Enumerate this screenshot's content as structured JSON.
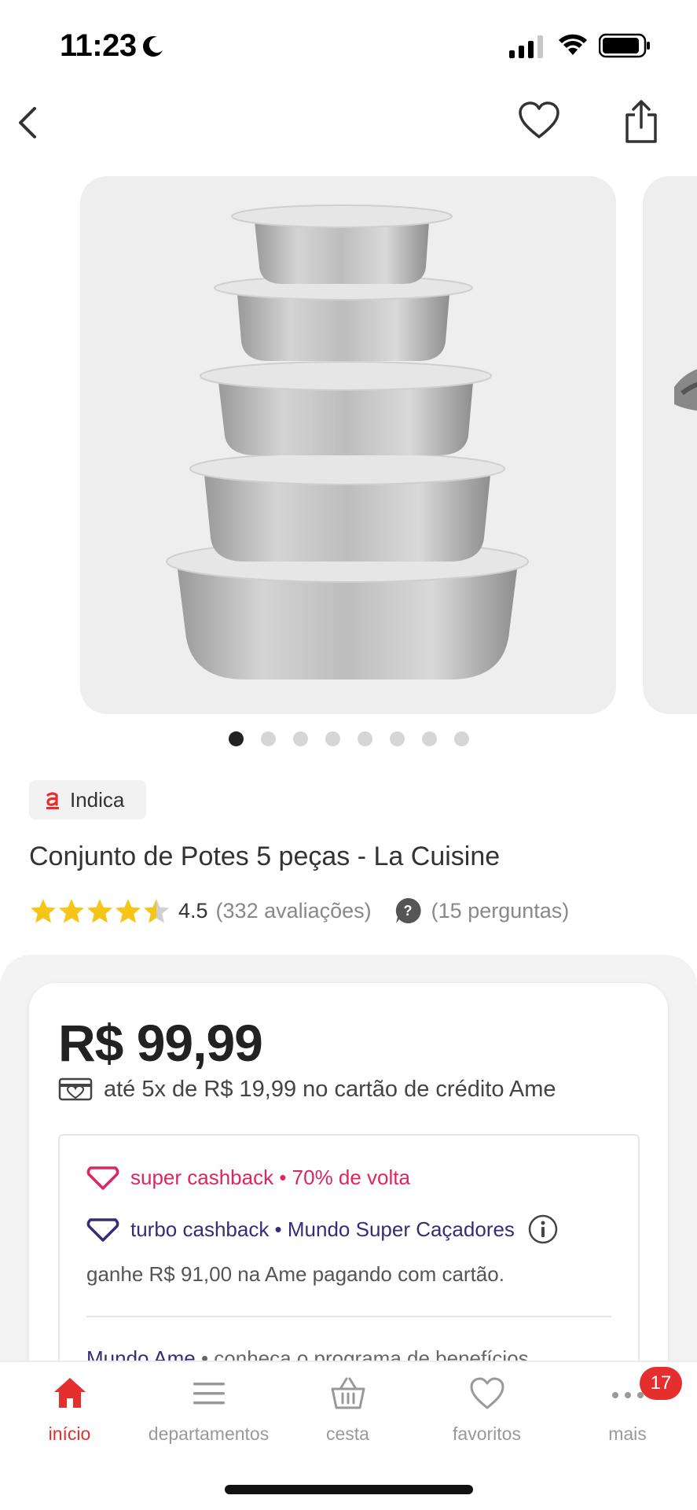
{
  "status_bar": {
    "time": "11:23",
    "icons": [
      "moon-icon",
      "signal-icon",
      "wifi-icon",
      "battery-icon"
    ]
  },
  "nav": {
    "icons": [
      "back-icon",
      "heart-icon",
      "share-icon"
    ]
  },
  "gallery": {
    "total_images": 8,
    "active_index": 0
  },
  "badge": {
    "text": "Indica",
    "logo": "a"
  },
  "product": {
    "title": "Conjunto de Potes 5 peças - La Cuisine",
    "rating": 4.5,
    "rating_text": "4.5",
    "reviews": "(332 avaliações)",
    "questions": "(15 perguntas)"
  },
  "price": {
    "value": "R$ 99,99",
    "installments": "até 5x de R$ 19,99 no cartão de crédito Ame"
  },
  "cashback": {
    "super_label": "super cashback • 70% de volta",
    "turbo_label": "turbo cashback • Mundo Super Caçadores",
    "earn_text": "ganhe R$ 91,00 na Ame pagando com cartão.",
    "mundo_label": "Mundo Ame",
    "mundo_rest": " • conheça o programa de benefícios",
    "colors": {
      "super": "#e0245e",
      "turbo": "#3a2a7a"
    }
  },
  "tabbar": {
    "items": [
      {
        "label": "início",
        "icon": "home-icon",
        "active": true
      },
      {
        "label": "departamentos",
        "icon": "menu-icon",
        "active": false
      },
      {
        "label": "cesta",
        "icon": "basket-icon",
        "active": false
      },
      {
        "label": "favoritos",
        "icon": "heart-icon",
        "active": false
      },
      {
        "label": "mais",
        "icon": "more-icon",
        "active": false
      }
    ],
    "more_badge": "17",
    "accent": "#e52e2e"
  }
}
